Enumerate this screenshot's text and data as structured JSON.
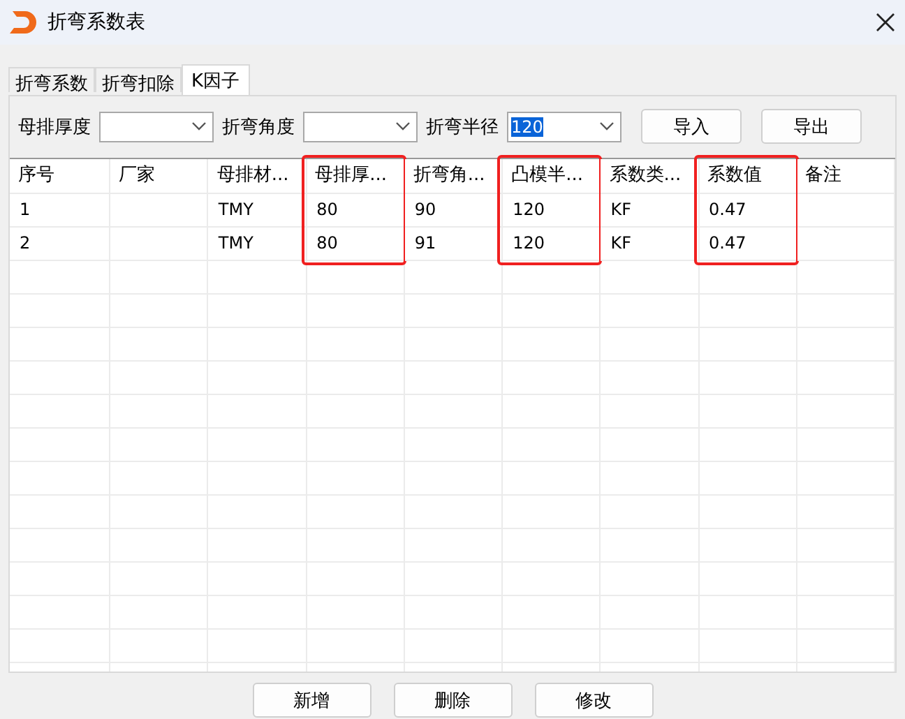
{
  "window": {
    "title": "折弯系数表"
  },
  "tabs": [
    {
      "label": "折弯系数",
      "selected": false
    },
    {
      "label": "折弯扣除",
      "selected": false
    },
    {
      "label": "K因子",
      "selected": true
    }
  ],
  "filters": [
    {
      "label": "母排厚度"
    },
    {
      "label": "折弯角度"
    },
    {
      "label": "折弯半径",
      "value": "120",
      "text_selected": true
    }
  ],
  "toolbar_buttons": [
    "导入",
    "导出"
  ],
  "table": {
    "columns": [
      {
        "label": "序号",
        "highlighted": false
      },
      {
        "label": "厂家",
        "highlighted": false
      },
      {
        "label": "母排材...",
        "highlighted": false
      },
      {
        "label": "母排厚...",
        "highlighted": true
      },
      {
        "label": "折弯角...",
        "highlighted": false
      },
      {
        "label": "凸模半...",
        "highlighted": true
      },
      {
        "label": "系数类...",
        "highlighted": false
      },
      {
        "label": "系数值",
        "highlighted": true
      },
      {
        "label": "备注",
        "highlighted": false
      }
    ],
    "rows": [
      [
        "1",
        "",
        "TMY",
        "80",
        "90",
        "120",
        "KF",
        "0.47",
        ""
      ],
      [
        "2",
        "",
        "TMY",
        "80",
        "91",
        "120",
        "KF",
        "0.47",
        ""
      ]
    ]
  },
  "buttons": [
    "新增",
    "删除",
    "修改"
  ]
}
